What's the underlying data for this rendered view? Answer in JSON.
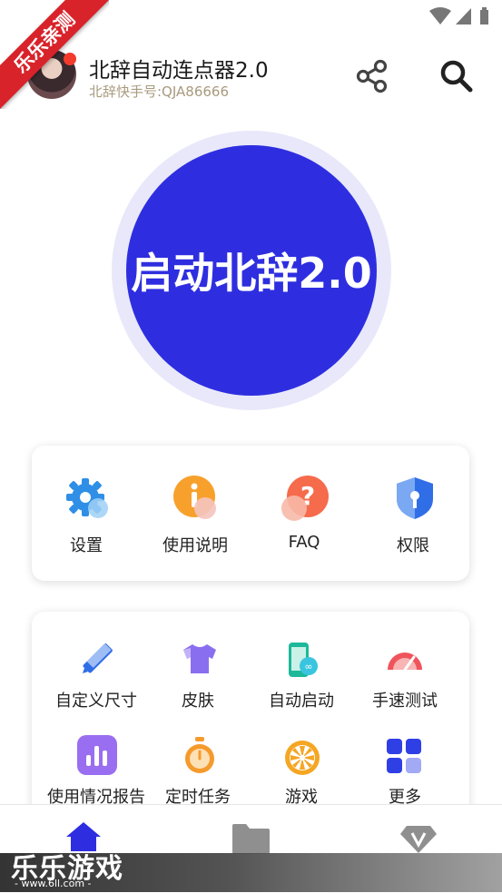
{
  "ribbon": {
    "text": "乐乐亲测"
  },
  "header": {
    "title": "北辞自动连点器2.0",
    "subtitle": "北辞快手号:QJA86666"
  },
  "main": {
    "start_label": "启动北辞2.0"
  },
  "menu_top": [
    {
      "label": "设置",
      "icon": "gear-icon"
    },
    {
      "label": "使用说明",
      "icon": "info-icon"
    },
    {
      "label": "FAQ",
      "icon": "question-icon"
    },
    {
      "label": "权限",
      "icon": "shield-key-icon"
    }
  ],
  "menu_tools": [
    {
      "label": "自定义尺寸",
      "icon": "ruler-pencil-icon"
    },
    {
      "label": "皮肤",
      "icon": "shirt-icon"
    },
    {
      "label": "自动启动",
      "icon": "phone-link-icon"
    },
    {
      "label": "手速测试",
      "icon": "speedometer-icon"
    },
    {
      "label": "使用情况报告",
      "icon": "bar-chart-icon"
    },
    {
      "label": "定时任务",
      "icon": "stopwatch-icon"
    },
    {
      "label": "游戏",
      "icon": "wheel-icon"
    },
    {
      "label": "更多",
      "icon": "grid-icon"
    }
  ],
  "nav": [
    {
      "icon": "home-icon",
      "active": true
    },
    {
      "icon": "folder-icon",
      "active": false
    },
    {
      "icon": "vip-diamond-icon",
      "active": false
    }
  ],
  "watermark": {
    "title": "乐乐游戏",
    "url": "- www.6ll.com -"
  },
  "colors": {
    "primary": "#2e2ee0",
    "ring": "#e8e8fa",
    "accent_red": "#d8232a"
  }
}
